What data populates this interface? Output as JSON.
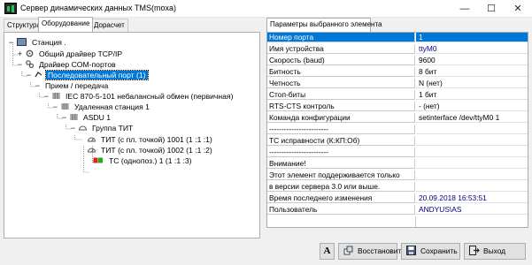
{
  "window": {
    "title": "Сервер динамических данных TMS(moxa)",
    "minimize_glyph": "—",
    "maximize_glyph": "☐",
    "close_glyph": "✕"
  },
  "tabs": [
    {
      "label": "Структура"
    },
    {
      "label": "Оборудование"
    },
    {
      "label": "Дорасчет"
    }
  ],
  "props_header": "Параметры выбранного элемента",
  "tree": {
    "nodes": [
      {
        "label": "Станция .",
        "expander": "−",
        "icon": "station-icon"
      },
      {
        "label": "Общий драйвер TCP/IP",
        "expander": "+",
        "icon": "network-driver-icon"
      },
      {
        "label": "Драйвер COM-портов",
        "expander": "−",
        "icon": "com-driver-icon"
      },
      {
        "label": "Последовательный порт  (1)",
        "expander": "−",
        "icon": "serial-port-icon"
      },
      {
        "label": "Прием / передача",
        "expander": "−",
        "icon": ""
      },
      {
        "label": "IEC 870-5-101 небалансный обмен (первичная)",
        "expander": "−",
        "icon": "protocol-icon"
      },
      {
        "label": "Удаленная станция  1",
        "expander": "−",
        "icon": "remote-station-icon"
      },
      {
        "label": "ASDU  1",
        "expander": "−",
        "icon": "asdu-icon"
      },
      {
        "label": "Группа ТИТ",
        "expander": "−",
        "icon": "group-icon"
      },
      {
        "label": "ТИТ (с пл. точкой) 1001 (1 :1 :1)",
        "expander": "",
        "icon": "measurement-icon"
      },
      {
        "label": "ТИТ (с пл. точкой) 1002 (1 :1 :2)",
        "expander": "",
        "icon": "measurement-icon"
      },
      {
        "label": "ТС (однопоз.) 1 (1 :1 :3)",
        "expander": "",
        "icon": "signal-icon"
      }
    ]
  },
  "properties": [
    {
      "name": "Номер порта",
      "value": "1",
      "selected": true
    },
    {
      "name": "Имя устройства",
      "value": "ttyM0"
    },
    {
      "name": "Скорость (baud)",
      "value": "9600"
    },
    {
      "name": "Битность",
      "value": "8 бит"
    },
    {
      "name": "Четность",
      "value": "N (нет)"
    },
    {
      "name": "Стоп-биты",
      "value": "1 бит"
    },
    {
      "name": "RTS-CTS контроль",
      "value": "- (нет)"
    },
    {
      "name": "Команда конфигурации",
      "value": "setinterface /dev/ttyM0 1"
    },
    {
      "name": "------------------------",
      "value": ""
    },
    {
      "name": "ТС исправности (К:КП:Об)",
      "value": ""
    },
    {
      "name": "------------------------",
      "value": ""
    },
    {
      "name": "Внимание!",
      "value": ""
    },
    {
      "name": "Этот элемент поддерживается  только",
      "value": ""
    },
    {
      "name": "в версии сервера 3.0 или выше.",
      "value": ""
    },
    {
      "name": "Время последнего изменения",
      "value": "20.09.2018 16:53:51"
    },
    {
      "name": "Пользователь",
      "value": "ANDYUS\\AS"
    }
  ],
  "toolbar": {
    "font_button": "A",
    "restore_label": "Восстановить",
    "save_label": "Сохранить",
    "exit_label": "Выход"
  },
  "colors": {
    "selection": "#0078d7",
    "value_text": "#000080"
  }
}
